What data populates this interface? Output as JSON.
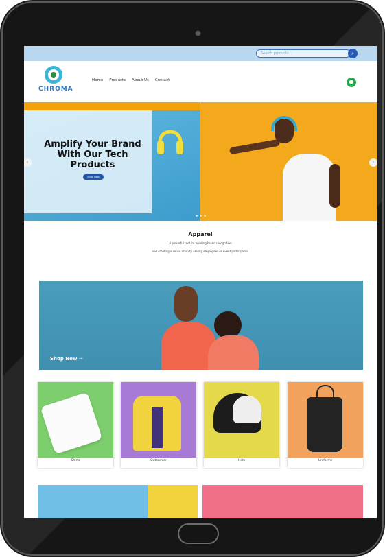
{
  "app": {
    "site_name": "CHROMA"
  },
  "search": {
    "placeholder": "Search products..."
  },
  "nav": {
    "items": [
      "Home",
      "Products",
      "About Us",
      "Contact"
    ]
  },
  "hero": {
    "title": "Amplify Your Brand With Our Tech Products",
    "cta": "Shop Now",
    "prev_icon": "chevron-left",
    "next_icon": "chevron-right"
  },
  "apparel": {
    "title": "Apparel",
    "description_line1": "A powerful tool for building brand recognition",
    "description_line2": "and creating a sense of unity among employees or event participants."
  },
  "banner": {
    "cta": "Shop Now →"
  },
  "categories": {
    "items": [
      {
        "label": "Shirts"
      },
      {
        "label": "Outerwear"
      },
      {
        "label": "Hats"
      },
      {
        "label": "Uniforms"
      }
    ]
  },
  "colors": {
    "topbar": "#b9d8ef",
    "accent_blue": "#1f56a8",
    "accent_orange": "#f3a30a",
    "chat_green": "#2aa54b"
  }
}
